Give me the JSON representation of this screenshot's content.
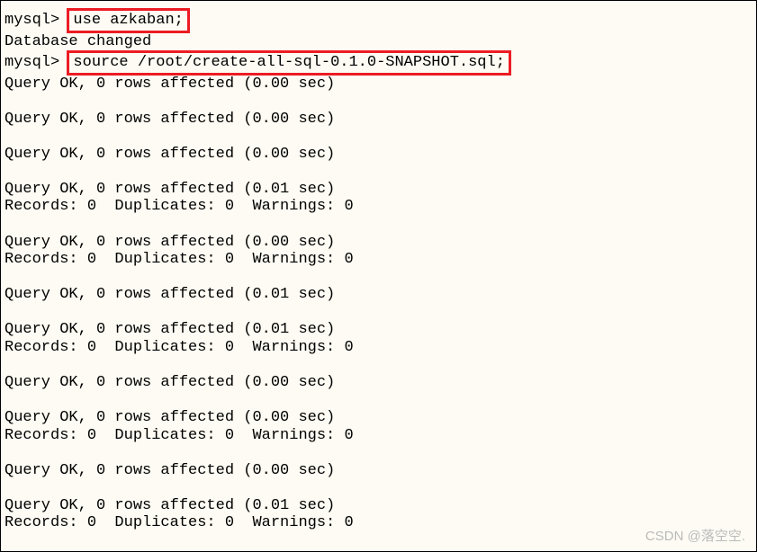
{
  "prompt": "mysql>",
  "commands": {
    "use": "use azkaban;",
    "source": "source /root/create-all-sql-0.1.0-SNAPSHOT.sql;"
  },
  "responses": {
    "db_changed": "Database changed",
    "query_ok_000": "Query OK, 0 rows affected (0.00 sec)",
    "query_ok_001": "Query OK, 0 rows affected (0.01 sec)",
    "records_line": "Records: 0  Duplicates: 0  Warnings: 0"
  },
  "watermark": "CSDN @落空空."
}
